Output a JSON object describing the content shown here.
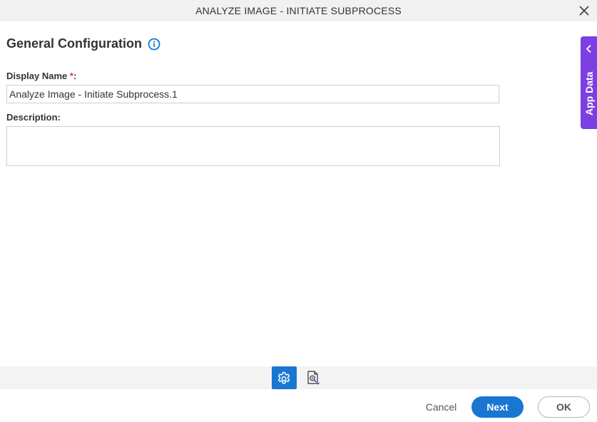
{
  "dialog": {
    "title": "ANALYZE IMAGE - INITIATE SUBPROCESS",
    "close_icon": "close-icon"
  },
  "section": {
    "title": "General Configuration",
    "info_icon": "info-icon"
  },
  "fields": {
    "display_name": {
      "label": "Display Name",
      "required_mark": "*",
      "suffix": ":",
      "value": "Analyze Image - Initiate Subprocess.1"
    },
    "description": {
      "label": "Description:",
      "value": ""
    }
  },
  "app_data_panel": {
    "label": "App Data",
    "icon": "chevron-left-icon",
    "color": "#7b3fe4"
  },
  "tabs": [
    {
      "icon": "gear-icon",
      "active": true
    },
    {
      "icon": "image-search-icon",
      "active": false
    }
  ],
  "footer": {
    "cancel_label": "Cancel",
    "next_label": "Next",
    "ok_label": "OK"
  },
  "colors": {
    "primary": "#1976d2",
    "required": "#e53935"
  }
}
